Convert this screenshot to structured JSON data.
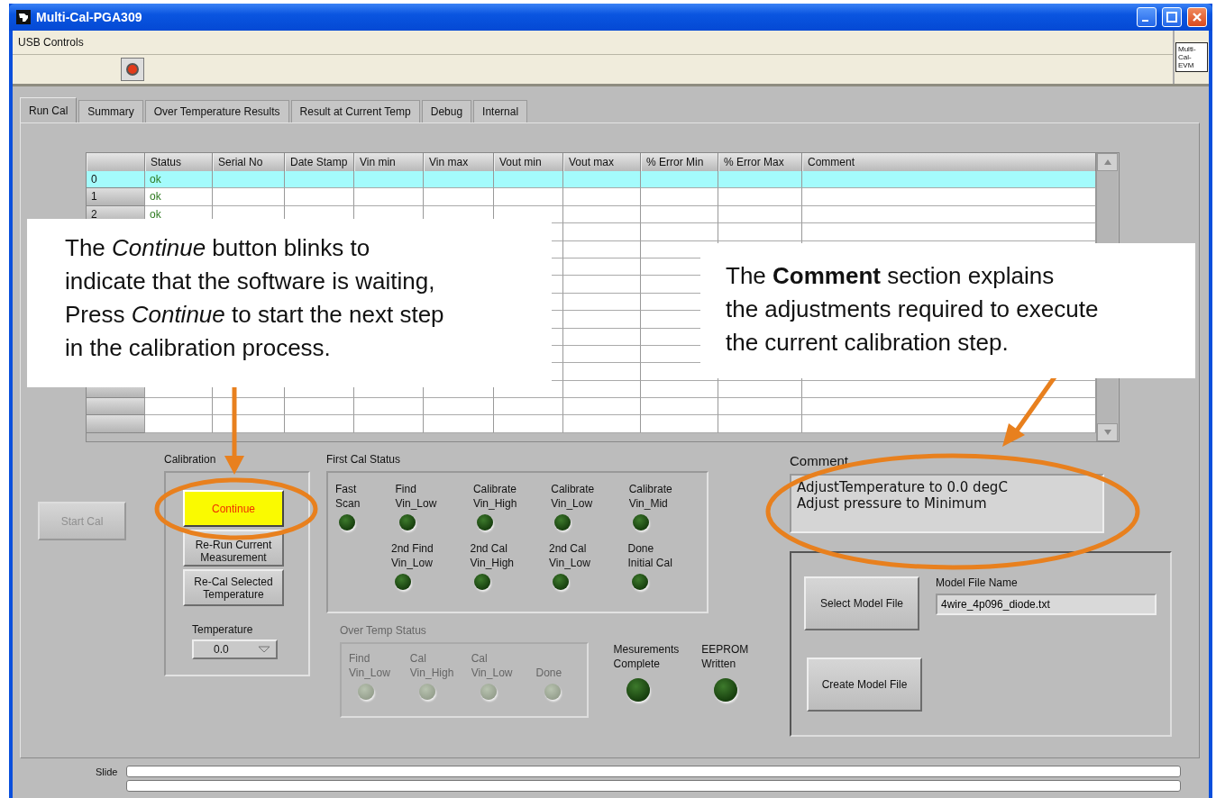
{
  "window": {
    "title": "Multi-Cal-PGA309"
  },
  "menu": {
    "label": "USB Controls"
  },
  "badge": "Multi-Cal-EVM",
  "tabs": [
    {
      "label": "Run Cal",
      "selected": true
    },
    {
      "label": "Summary",
      "selected": false
    },
    {
      "label": "Over Temperature Results",
      "selected": false
    },
    {
      "label": "Result at Current Temp",
      "selected": false
    },
    {
      "label": "Debug",
      "selected": false
    },
    {
      "label": "Internal",
      "selected": false
    }
  ],
  "table": {
    "columns": [
      "Status",
      "Serial No",
      "Date Stamp",
      "Vin min",
      "Vin max",
      "Vout min",
      "Vout max",
      "% Error Min",
      "% Error Max",
      "Comment"
    ],
    "rows": [
      {
        "index": "0",
        "status": "ok",
        "selected": true
      },
      {
        "index": "1",
        "status": "ok",
        "selected": false
      },
      {
        "index": "2",
        "status": "ok",
        "selected": false
      }
    ]
  },
  "start_cal": {
    "label": "Start Cal",
    "disabled": true
  },
  "calibration": {
    "title": "Calibration",
    "buttons": [
      {
        "label": "Continue",
        "kind": "highlight"
      },
      {
        "label": "Re-Run Current Measurement",
        "kind": "normal"
      },
      {
        "label": "Re-Cal Selected Temperature",
        "kind": "normal"
      }
    ],
    "temperature": {
      "label": "Temperature",
      "value": "0.0"
    }
  },
  "first_cal_status": {
    "title": "First Cal Status",
    "rows": [
      {
        "items": [
          {
            "label": "Fast\nScan",
            "on": false
          },
          {
            "label": "Find\nVin_Low",
            "on": false
          },
          {
            "label": "Calibrate\nVin_High",
            "on": false
          },
          {
            "label": "Calibrate\nVin_Low",
            "on": false
          },
          {
            "label": "Calibrate\nVin_Mid",
            "on": false
          }
        ]
      },
      {
        "items": [
          {
            "label": "2nd Find\nVin_Low",
            "on": false
          },
          {
            "label": "2nd Cal\nVin_High",
            "on": false
          },
          {
            "label": "2nd Cal\nVin_Low",
            "on": false
          },
          {
            "label": "Done\nInitial Cal",
            "on": false
          }
        ]
      }
    ]
  },
  "over_temp_status": {
    "title": "Over Temp Status",
    "disabled": true,
    "items": [
      {
        "label": "Find\nVin_Low",
        "on": false
      },
      {
        "label": "Cal\nVin_High",
        "on": false
      },
      {
        "label": "Cal\nVin_Low",
        "on": false
      },
      {
        "label": "Done",
        "on": false
      }
    ]
  },
  "indicators": [
    {
      "label": "Mesurements\nComplete",
      "on": false
    },
    {
      "label": "EEPROM\nWritten",
      "on": false
    }
  ],
  "comment": {
    "label": "Comment",
    "lines": [
      "AdjustTemperature to 0.0 degC",
      "Adjust pressure to Minimum"
    ]
  },
  "model_file": {
    "select_button": "Select Model File",
    "name_label": "Model File Name",
    "name_value": "4wire_4p096_diode.txt",
    "create_button": "Create Model File"
  },
  "slide": {
    "label": "Slide"
  },
  "callouts": [
    {
      "text": "The *Continue* button blinks to\nindicate that the software is waiting,\nPress *Continue* to start the next step\nin the calibration process."
    },
    {
      "text": "The **Comment** section explains\nthe adjustments required to execute\nthe current calibration step."
    }
  ]
}
